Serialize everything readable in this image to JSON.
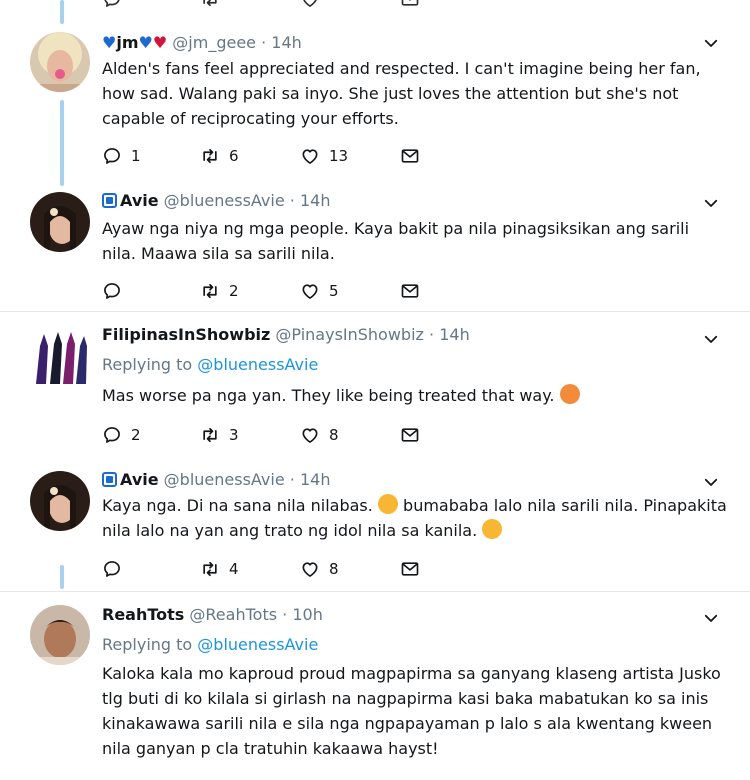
{
  "tweets": [
    {
      "name": "jm",
      "handle": "@jm_geee",
      "dot": "·",
      "time": "14h",
      "text": "Alden's fans feel appreciated and respected. I can't imagine being her fan, how sad. Walang paki sa inyo. She just loves the attention but she's not capable of reciprocating your efforts.",
      "replies": "1",
      "retweets": "6",
      "likes": "13"
    },
    {
      "name": "Avie",
      "handle": "@bluenessAvie",
      "dot": "·",
      "time": "14h",
      "text": "Ayaw nga niya ng mga people. Kaya bakit pa nila pinagsiksikan ang sarili nila. Maawa sila sa sarili nila.",
      "replies": "",
      "retweets": "2",
      "likes": "5"
    },
    {
      "name": "FilipinasInShowbiz",
      "handle": "@PinaysInShowbiz",
      "dot": "·",
      "time": "14h",
      "replying_label": "Replying to",
      "replying_to": "@bluenessAvie",
      "text": "Mas worse pa nga yan. They like being treated that way.",
      "replies": "2",
      "retweets": "3",
      "likes": "8"
    },
    {
      "name": "Avie",
      "handle": "@bluenessAvie",
      "dot": "·",
      "time": "14h",
      "text_a": "Kaya nga. Di na sana nila nilabas.",
      "text_b": "bumababa lalo nila sarili nila. Pinapakita nila lalo na yan ang trato ng idol nila sa kanila.",
      "replies": "",
      "retweets": "4",
      "likes": "8"
    },
    {
      "name": "ReahTots",
      "handle": "@ReahTots",
      "dot": "·",
      "time": "10h",
      "replying_label": "Replying to",
      "replying_to": "@bluenessAvie",
      "text": "Kaloka kala mo kaproud proud magpapirma sa ganyang klaseng artista Jusko tlg buti di ko kilala si girlash na nagpapirma kasi baka mabatukan ko sa inis kinakawawa sarili nila e sila nga ngpapayaman p lalo s ala kwentang kween nila ganyan p cla tratuhin kakaawa hayst!"
    }
  ],
  "icons": [
    "reply-icon",
    "retweet-icon",
    "like-icon",
    "message-icon",
    "chevron-down-icon"
  ],
  "colors": {
    "thread_line": "#a9d0ec",
    "link": "#1b95e0",
    "muted": "#657786",
    "badge": "#1b6ad1"
  }
}
